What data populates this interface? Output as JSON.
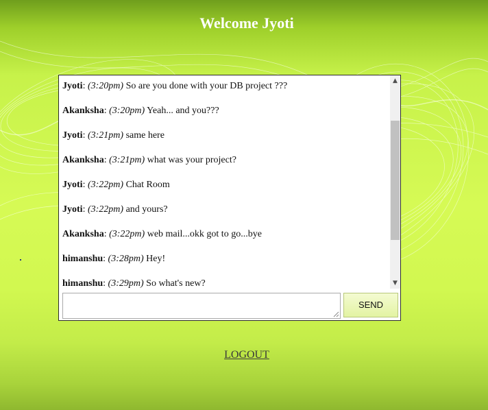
{
  "page": {
    "title": "Welcome Jyoti"
  },
  "chat": {
    "messages": [
      {
        "user": "Jyoti",
        "time": "(3:20pm)",
        "text": " So are you done with your DB project ???"
      },
      {
        "user": "Akanksha",
        "time": "(3:20pm)",
        "text": " Yeah... and you???"
      },
      {
        "user": "Jyoti",
        "time": "(3:21pm)",
        "text": " same here"
      },
      {
        "user": "Akanksha",
        "time": "(3:21pm)",
        "text": " what was your project?"
      },
      {
        "user": "Jyoti",
        "time": "(3:22pm)",
        "text": " Chat Room"
      },
      {
        "user": "Jyoti",
        "time": "(3:22pm)",
        "text": " and yours?"
      },
      {
        "user": "Akanksha",
        "time": "(3:22pm)",
        "text": " web mail...okk got to go...bye"
      },
      {
        "user": "himanshu",
        "time": "(3:28pm)",
        "text": " Hey!"
      },
      {
        "user": "himanshu",
        "time": "(3:29pm)",
        "text": " So what's new?"
      }
    ],
    "separator": ": ",
    "input_value": "",
    "send_label": "SEND"
  },
  "icons": {
    "scroll_up": "chevron-up-icon",
    "scroll_down": "chevron-down-icon",
    "resize_grip": "resize-grip-icon"
  },
  "logout_label": "LOGOUT",
  "colors": {
    "background": "#d6fa55",
    "send_button": "#e3f3a3",
    "title_text": "#ffffff"
  }
}
